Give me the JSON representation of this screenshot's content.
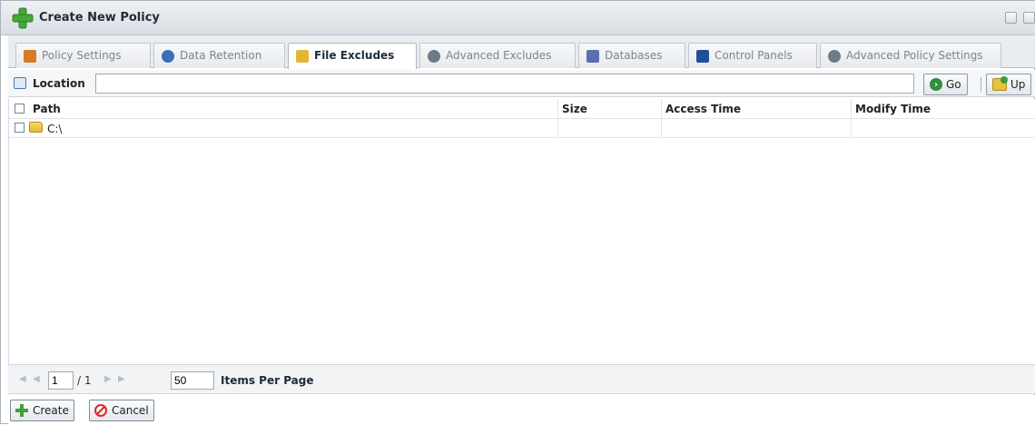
{
  "window": {
    "title": "Create New Policy"
  },
  "tabs": [
    {
      "label": "Policy Settings",
      "icon": "clipboard-icon",
      "color": "#d87a26",
      "active": false
    },
    {
      "label": "Data Retention",
      "icon": "people-icon",
      "color": "#3b6fb6",
      "active": false
    },
    {
      "label": "File Excludes",
      "icon": "folder-icon",
      "color": "#e3b631",
      "active": true
    },
    {
      "label": "Advanced Excludes",
      "icon": "gears-icon",
      "color": "#6b7b8c",
      "active": false
    },
    {
      "label": "Databases",
      "icon": "database-icon",
      "color": "#5b6fb0",
      "active": false
    },
    {
      "label": "Control Panels",
      "icon": "book-icon",
      "color": "#1f4f9c",
      "active": false
    },
    {
      "label": "Advanced Policy Settings",
      "icon": "gears-icon",
      "color": "#6b7b8c",
      "active": false
    }
  ],
  "location": {
    "label": "Location",
    "value": "",
    "go_label": "Go",
    "up_label": "Up"
  },
  "table": {
    "columns": [
      "Path",
      "Size",
      "Access Time",
      "Modify Time"
    ],
    "rows": [
      {
        "path": "C:\\",
        "size": "",
        "access_time": "",
        "modify_time": ""
      }
    ]
  },
  "pager": {
    "page": "1",
    "of_text": "/ 1",
    "items_per_page": "50",
    "items_label": "Items Per Page"
  },
  "footer": {
    "create_label": "Create",
    "cancel_label": "Cancel"
  }
}
